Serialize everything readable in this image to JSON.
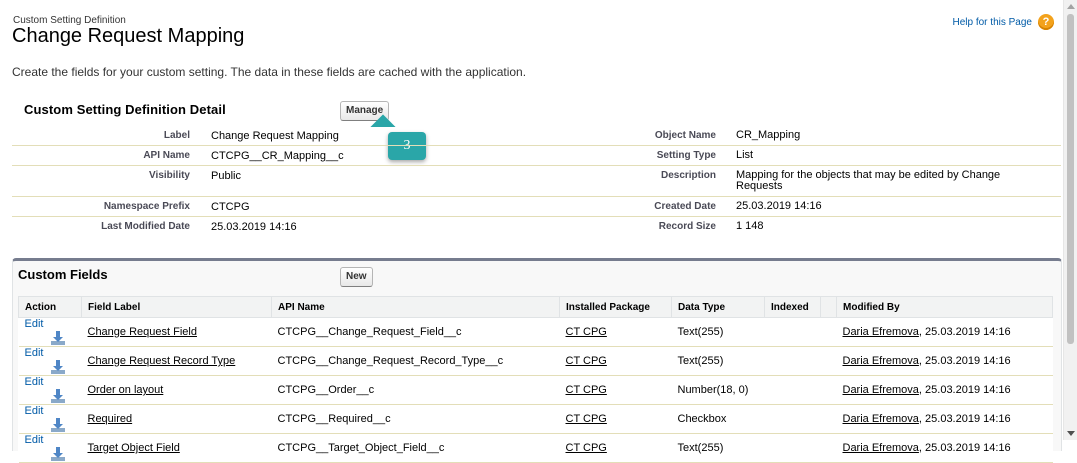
{
  "header": {
    "subtitle": "Custom Setting Definition",
    "title": "Change Request Mapping",
    "help_link": "Help for this Page",
    "help_icon": "question-icon",
    "description": "Create the fields for your custom setting. The data in these fields are cached with the application."
  },
  "detail": {
    "title": "Custom Setting Definition Detail",
    "manage_label": "Manage",
    "callout": "3",
    "rows": [
      {
        "l1": "Label",
        "v1": "Change Request Mapping",
        "l2": "Object Name",
        "v2": "CR_Mapping"
      },
      {
        "l1": "API Name",
        "v1": "CTCPG__CR_Mapping__c",
        "l2": "Setting Type",
        "v2": "List"
      },
      {
        "l1": "Visibility",
        "v1": "Public",
        "l2": "Description",
        "v2": "Mapping for the objects that may be edited by Change Requests"
      },
      {
        "l1": "Namespace Prefix",
        "v1": "CTCPG",
        "l2": "Created Date",
        "v2": "25.03.2019 14:16"
      },
      {
        "l1": "Last Modified Date",
        "v1": "25.03.2019 14:16",
        "l2": "Record Size",
        "v2": "1 148"
      }
    ]
  },
  "custom_fields": {
    "title": "Custom Fields",
    "new_label": "New",
    "columns": [
      "Action",
      "Field Label",
      "API Name",
      "Installed Package",
      "Data Type",
      "Indexed",
      "",
      "Modified By"
    ],
    "rows": [
      {
        "action": "Edit",
        "label": "Change Request Field",
        "api": "CTCPG__Change_Request_Field__c",
        "package": "CT CPG",
        "type": "Text(255)",
        "indexed": "",
        "modified_user": "Daria Efremova",
        "modified_date": ", 25.03.2019 14:16"
      },
      {
        "action": "Edit",
        "label": "Change Request Record Type",
        "api": "CTCPG__Change_Request_Record_Type__c",
        "package": "CT CPG",
        "type": "Text(255)",
        "indexed": "",
        "modified_user": "Daria Efremova",
        "modified_date": ", 25.03.2019 14:16"
      },
      {
        "action": "Edit",
        "label": "Order on layout",
        "api": "CTCPG__Order__c",
        "package": "CT CPG",
        "type": "Number(18, 0)",
        "indexed": "",
        "modified_user": "Daria Efremova",
        "modified_date": ", 25.03.2019 14:16"
      },
      {
        "action": "Edit",
        "label": "Required",
        "api": "CTCPG__Required__c",
        "package": "CT CPG",
        "type": "Checkbox",
        "indexed": "",
        "modified_user": "Daria Efremova",
        "modified_date": ", 25.03.2019 14:16"
      },
      {
        "action": "Edit",
        "label": "Target Object Field",
        "api": "CTCPG__Target_Object_Field__c",
        "package": "CT CPG",
        "type": "Text(255)",
        "indexed": "",
        "modified_user": "Daria Efremova",
        "modified_date": ", 25.03.2019 14:16"
      }
    ],
    "row_icon": "download-icon"
  },
  "colors": {
    "link": "#015ba7",
    "callout": "#2aa6a8",
    "help_icon": "#f3a21c"
  }
}
